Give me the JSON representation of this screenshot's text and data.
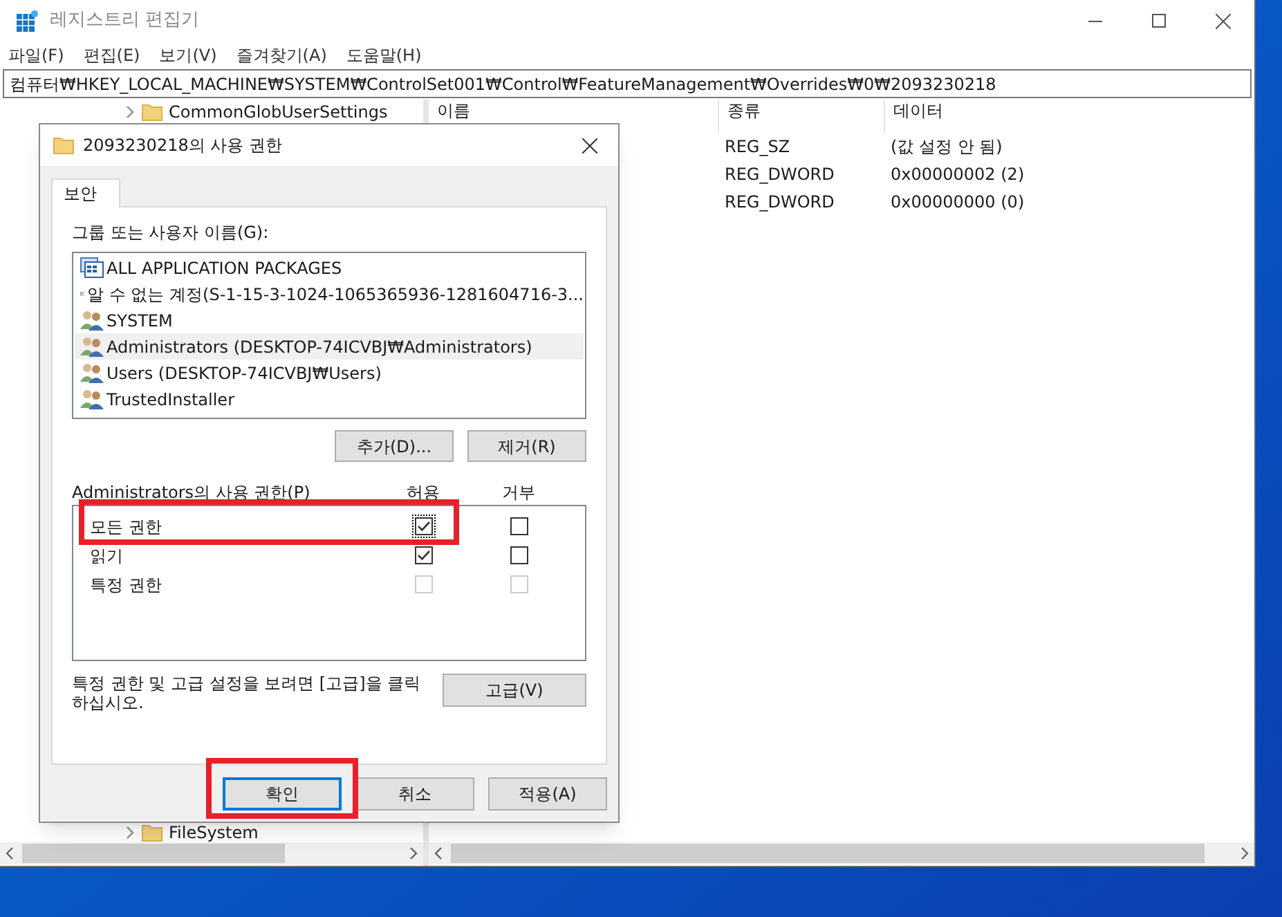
{
  "window": {
    "title": "레지스트리 편집기"
  },
  "menu": [
    "파일(F)",
    "편집(E)",
    "보기(V)",
    "즐겨찾기(A)",
    "도움말(H)"
  ],
  "address": "컴퓨터₩HKEY_LOCAL_MACHINE₩SYSTEM₩ControlSet001₩Control₩FeatureManagement₩Overrides₩0₩2093230218",
  "tree": {
    "items": [
      {
        "label": "CommonGlobUserSettings",
        "expanded": false
      },
      {
        "label": "FileSystem",
        "expanded": false
      }
    ]
  },
  "values": {
    "columns": [
      "이름",
      "종류",
      "데이터"
    ],
    "rows": [
      {
        "type": "REG_SZ",
        "data": "(값 설정 안 됨)"
      },
      {
        "type": "REG_DWORD",
        "data": "0x00000002 (2)"
      },
      {
        "type": "REG_DWORD",
        "data": "0x00000000 (0)"
      }
    ]
  },
  "dialog": {
    "title": "2093230218의 사용 권한",
    "tabs": [
      {
        "label": "보안",
        "selected": true
      }
    ],
    "principals_label": "그룹 또는 사용자 이름(G):",
    "principals": [
      {
        "label": "ALL APPLICATION PACKAGES",
        "kind": "package",
        "selected": false
      },
      {
        "label": "알 수 없는 계정(S-1-15-3-1024-1065365936-1281604716-3...",
        "kind": "account",
        "selected": false
      },
      {
        "label": "SYSTEM",
        "kind": "group",
        "selected": false
      },
      {
        "label": "Administrators (DESKTOP-74ICVBJ₩Administrators)",
        "kind": "group",
        "selected": true
      },
      {
        "label": "Users (DESKTOP-74ICVBJ₩Users)",
        "kind": "group",
        "selected": false
      },
      {
        "label": "TrustedInstaller",
        "kind": "group",
        "selected": false
      }
    ],
    "add_button": "추가(D)...",
    "remove_button": "제거(R)",
    "permissions_label": "Administrators의 사용 권한(P)",
    "allow_header": "허용",
    "deny_header": "거부",
    "permissions": [
      {
        "label": "모든 권한",
        "allow": {
          "checked": true,
          "disabled": false,
          "focused": true
        },
        "deny": {
          "checked": false,
          "disabled": false,
          "focused": false
        }
      },
      {
        "label": "읽기",
        "allow": {
          "checked": true,
          "disabled": false,
          "focused": false
        },
        "deny": {
          "checked": false,
          "disabled": false,
          "focused": false
        }
      },
      {
        "label": "특정 권한",
        "allow": {
          "checked": false,
          "disabled": true,
          "focused": false
        },
        "deny": {
          "checked": false,
          "disabled": true,
          "focused": false
        }
      }
    ],
    "note": "특정 권한 및 고급 설정을 보려면 [고급]을 클릭하십시오.",
    "advanced_button": "고급(V)",
    "buttons": [
      {
        "label": "확인",
        "default": true
      },
      {
        "label": "취소",
        "default": false
      },
      {
        "label": "적용(A)",
        "default": false
      }
    ]
  }
}
